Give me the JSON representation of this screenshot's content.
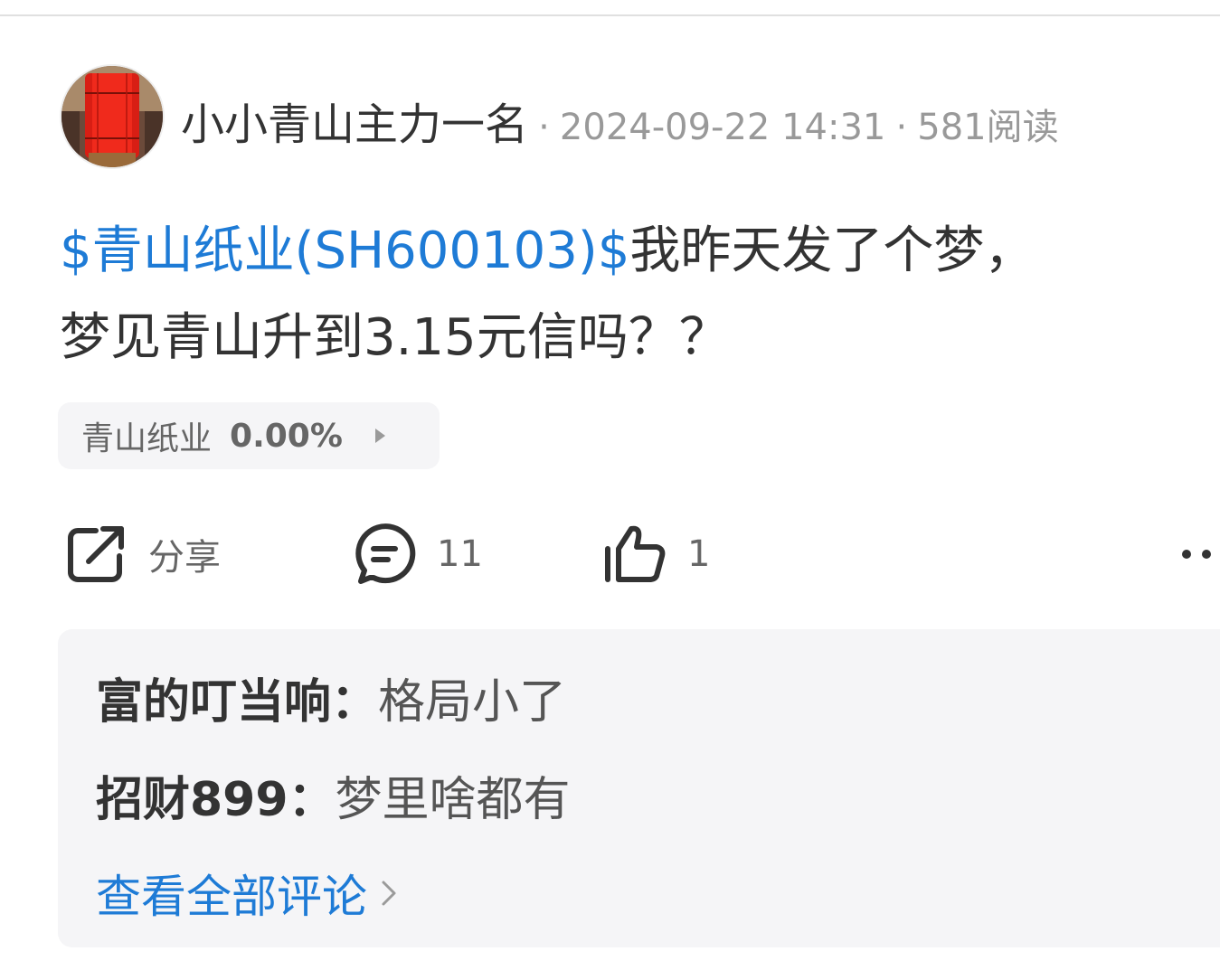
{
  "post": {
    "author": "小小青山主力一名",
    "separator": "·",
    "timestamp": "2024-09-22 14:31",
    "reads": "581阅读",
    "stock_tag": "$青山纸业(SH600103)$",
    "text_line1": "我昨天发了个梦，",
    "text_line2": "梦见青山升到3.15元信吗？？"
  },
  "stock_chip": {
    "name": "青山纸业",
    "change": "0.00%"
  },
  "actions": {
    "share_label": "分享",
    "comment_count": "11",
    "like_count": "1"
  },
  "comments": [
    {
      "user": "富的叮当响：",
      "text": "格局小了"
    },
    {
      "user": "招财899：",
      "text": "梦里啥都有"
    }
  ],
  "view_all_label": "查看全部评论",
  "colors": {
    "link": "#1e7bd6",
    "text": "#333333",
    "meta": "#999999",
    "panel": "#f5f5f7"
  },
  "icons": [
    "avatar-image",
    "share-icon",
    "comment-icon",
    "like-icon",
    "more-icon",
    "chevron-right-icon",
    "triangle-right-icon"
  ]
}
